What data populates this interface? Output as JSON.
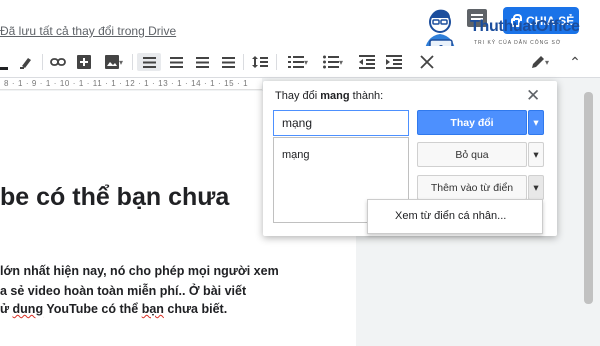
{
  "header": {
    "save_status": "Đã lưu tất cả thay đổi trong Drive",
    "share_label": "CHIA SẺ",
    "logo_text": "ThuthuatOffice",
    "logo_tagline": "TRI KỶ CỦA DÂN CÔNG SỞ"
  },
  "toolbar": {
    "icons": [
      "font-color-icon",
      "highlight-icon",
      "link-icon",
      "comment-add-icon",
      "image-icon",
      "align-left-icon",
      "align-center-icon",
      "align-right-icon",
      "align-justify-icon",
      "line-spacing-icon",
      "numbered-list-icon",
      "bulleted-list-icon",
      "decrease-indent-icon",
      "increase-indent-icon",
      "clear-format-icon",
      "edit-mode-icon",
      "collapse-icon"
    ]
  },
  "ruler": "8 · 1 · 9 · 1 · 10 · 1 · 11 · 1 · 12 · 1 · 13 · 1 · 14 · 1 · 15 · 1",
  "document": {
    "heading_fragment": "be có thể bạn chưa",
    "line1": "lớn nhất hiện nay, nó cho phép mọi người xem",
    "line2": "a sẻ video hoàn toàn miễn phí.. Ở bài viết",
    "line3_prefix": "ử ",
    "line3_err1": "dung",
    "line3_mid": " YouTube có thể ",
    "line3_err2": "bạn",
    "line3_suffix": " chưa biết."
  },
  "dialog": {
    "title_prefix": "Thay đổi ",
    "title_word": "mang",
    "title_suffix": " thành:",
    "input_value": "mạng",
    "suggestion": "mạng",
    "change_label": "Thay đổi",
    "ignore_label": "Bỏ qua",
    "add_label": "Thêm vào từ điển",
    "menu_item": "Xem từ điển cá nhân..."
  },
  "colors": {
    "accent": "#4d90fe",
    "share": "#1a73e8",
    "logo": "#1c4e9d"
  }
}
